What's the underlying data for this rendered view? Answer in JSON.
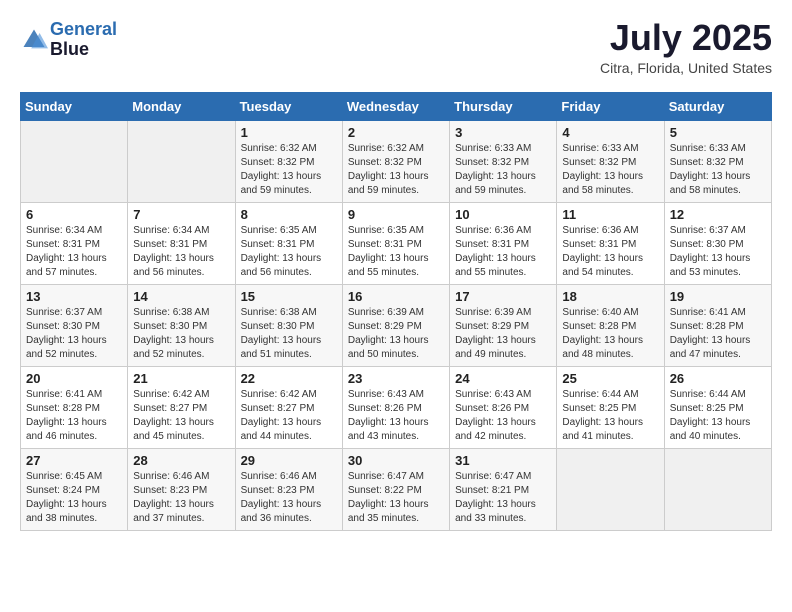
{
  "header": {
    "logo_line1": "General",
    "logo_line2": "Blue",
    "month": "July 2025",
    "location": "Citra, Florida, United States"
  },
  "weekdays": [
    "Sunday",
    "Monday",
    "Tuesday",
    "Wednesday",
    "Thursday",
    "Friday",
    "Saturday"
  ],
  "weeks": [
    [
      {
        "day": "",
        "info": ""
      },
      {
        "day": "",
        "info": ""
      },
      {
        "day": "1",
        "info": "Sunrise: 6:32 AM\nSunset: 8:32 PM\nDaylight: 13 hours and 59 minutes."
      },
      {
        "day": "2",
        "info": "Sunrise: 6:32 AM\nSunset: 8:32 PM\nDaylight: 13 hours and 59 minutes."
      },
      {
        "day": "3",
        "info": "Sunrise: 6:33 AM\nSunset: 8:32 PM\nDaylight: 13 hours and 59 minutes."
      },
      {
        "day": "4",
        "info": "Sunrise: 6:33 AM\nSunset: 8:32 PM\nDaylight: 13 hours and 58 minutes."
      },
      {
        "day": "5",
        "info": "Sunrise: 6:33 AM\nSunset: 8:32 PM\nDaylight: 13 hours and 58 minutes."
      }
    ],
    [
      {
        "day": "6",
        "info": "Sunrise: 6:34 AM\nSunset: 8:31 PM\nDaylight: 13 hours and 57 minutes."
      },
      {
        "day": "7",
        "info": "Sunrise: 6:34 AM\nSunset: 8:31 PM\nDaylight: 13 hours and 56 minutes."
      },
      {
        "day": "8",
        "info": "Sunrise: 6:35 AM\nSunset: 8:31 PM\nDaylight: 13 hours and 56 minutes."
      },
      {
        "day": "9",
        "info": "Sunrise: 6:35 AM\nSunset: 8:31 PM\nDaylight: 13 hours and 55 minutes."
      },
      {
        "day": "10",
        "info": "Sunrise: 6:36 AM\nSunset: 8:31 PM\nDaylight: 13 hours and 55 minutes."
      },
      {
        "day": "11",
        "info": "Sunrise: 6:36 AM\nSunset: 8:31 PM\nDaylight: 13 hours and 54 minutes."
      },
      {
        "day": "12",
        "info": "Sunrise: 6:37 AM\nSunset: 8:30 PM\nDaylight: 13 hours and 53 minutes."
      }
    ],
    [
      {
        "day": "13",
        "info": "Sunrise: 6:37 AM\nSunset: 8:30 PM\nDaylight: 13 hours and 52 minutes."
      },
      {
        "day": "14",
        "info": "Sunrise: 6:38 AM\nSunset: 8:30 PM\nDaylight: 13 hours and 52 minutes."
      },
      {
        "day": "15",
        "info": "Sunrise: 6:38 AM\nSunset: 8:30 PM\nDaylight: 13 hours and 51 minutes."
      },
      {
        "day": "16",
        "info": "Sunrise: 6:39 AM\nSunset: 8:29 PM\nDaylight: 13 hours and 50 minutes."
      },
      {
        "day": "17",
        "info": "Sunrise: 6:39 AM\nSunset: 8:29 PM\nDaylight: 13 hours and 49 minutes."
      },
      {
        "day": "18",
        "info": "Sunrise: 6:40 AM\nSunset: 8:28 PM\nDaylight: 13 hours and 48 minutes."
      },
      {
        "day": "19",
        "info": "Sunrise: 6:41 AM\nSunset: 8:28 PM\nDaylight: 13 hours and 47 minutes."
      }
    ],
    [
      {
        "day": "20",
        "info": "Sunrise: 6:41 AM\nSunset: 8:28 PM\nDaylight: 13 hours and 46 minutes."
      },
      {
        "day": "21",
        "info": "Sunrise: 6:42 AM\nSunset: 8:27 PM\nDaylight: 13 hours and 45 minutes."
      },
      {
        "day": "22",
        "info": "Sunrise: 6:42 AM\nSunset: 8:27 PM\nDaylight: 13 hours and 44 minutes."
      },
      {
        "day": "23",
        "info": "Sunrise: 6:43 AM\nSunset: 8:26 PM\nDaylight: 13 hours and 43 minutes."
      },
      {
        "day": "24",
        "info": "Sunrise: 6:43 AM\nSunset: 8:26 PM\nDaylight: 13 hours and 42 minutes."
      },
      {
        "day": "25",
        "info": "Sunrise: 6:44 AM\nSunset: 8:25 PM\nDaylight: 13 hours and 41 minutes."
      },
      {
        "day": "26",
        "info": "Sunrise: 6:44 AM\nSunset: 8:25 PM\nDaylight: 13 hours and 40 minutes."
      }
    ],
    [
      {
        "day": "27",
        "info": "Sunrise: 6:45 AM\nSunset: 8:24 PM\nDaylight: 13 hours and 38 minutes."
      },
      {
        "day": "28",
        "info": "Sunrise: 6:46 AM\nSunset: 8:23 PM\nDaylight: 13 hours and 37 minutes."
      },
      {
        "day": "29",
        "info": "Sunrise: 6:46 AM\nSunset: 8:23 PM\nDaylight: 13 hours and 36 minutes."
      },
      {
        "day": "30",
        "info": "Sunrise: 6:47 AM\nSunset: 8:22 PM\nDaylight: 13 hours and 35 minutes."
      },
      {
        "day": "31",
        "info": "Sunrise: 6:47 AM\nSunset: 8:21 PM\nDaylight: 13 hours and 33 minutes."
      },
      {
        "day": "",
        "info": ""
      },
      {
        "day": "",
        "info": ""
      }
    ]
  ]
}
